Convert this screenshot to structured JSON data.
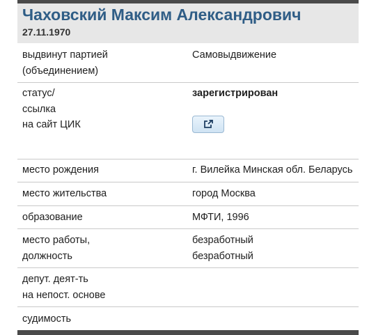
{
  "candidate": {
    "name": "Чаховский Максим Александрович",
    "birth_date": "27.11.1970"
  },
  "rows": {
    "nominated": {
      "label1": "выдвинут партией",
      "label2": "(объединением)",
      "value": "Самовыдвижение"
    },
    "status": {
      "label1": "статус/",
      "label2": "ссылка",
      "label3": "на сайт ЦИК",
      "value": "зарегистрирован",
      "link_icon": "external-link-icon"
    },
    "birthplace": {
      "label": "место рождения",
      "value": "г. Вилейка Минская обл. Беларусь"
    },
    "residence": {
      "label": "место жительства",
      "value": "город Москва"
    },
    "education": {
      "label": "образование",
      "value": "МФТИ, 1996"
    },
    "work": {
      "label1": "место работы,",
      "label2": "должность",
      "value1": "безработный",
      "value2": "безработный"
    },
    "deputy": {
      "label1": "депут. деят-ть",
      "label2": "на непост. основе",
      "value": ""
    },
    "conviction": {
      "label": "судимость",
      "value": ""
    }
  },
  "colors": {
    "name": "#2f5d86",
    "header_bg": "#e7e7e7",
    "bar": "#4a4a4a",
    "divider": "#c9c9c9",
    "button_border": "#9ab8d2"
  }
}
